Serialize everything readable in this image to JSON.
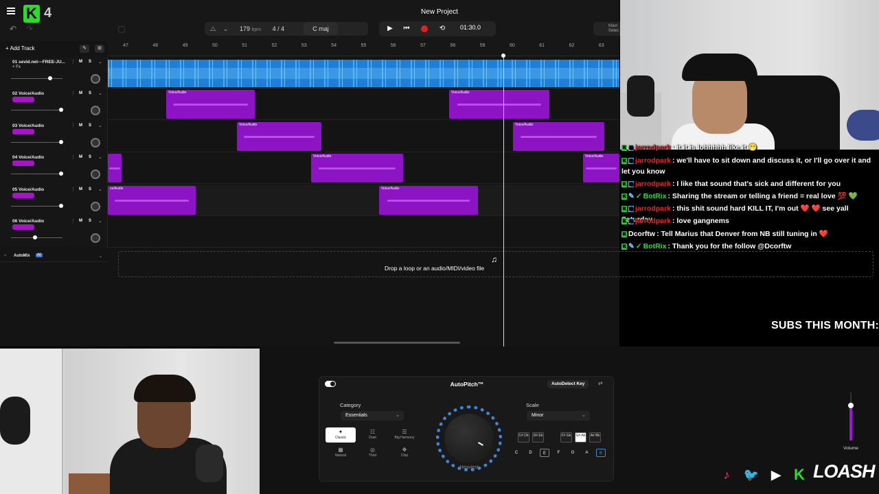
{
  "app": {
    "logo_letter": "K",
    "version": "4",
    "project_title": "New Project",
    "accent": "#2bdc2e"
  },
  "toolbar": {
    "bpm_value": "179",
    "bpm_unit": "bpm",
    "time_signature": "4 / 4",
    "key": "C maj",
    "time_display": "01:30.0",
    "master_label": "Mast",
    "master_sub": "Selec"
  },
  "track_header": {
    "add_track_label": "Add Track"
  },
  "ruler": [
    "47",
    "48",
    "49",
    "50",
    "51",
    "52",
    "53",
    "54",
    "55",
    "56",
    "57",
    "58",
    "59",
    "60",
    "61",
    "62",
    "63"
  ],
  "tracks": [
    {
      "name": "01  sevid.net---FREE-JU...",
      "sub": "+ Fx"
    },
    {
      "name": "02  Voice/Audio",
      "sub": ""
    },
    {
      "name": "03  Voice/Audio",
      "sub": ""
    },
    {
      "name": "04  Voice/Audio",
      "sub": ""
    },
    {
      "name": "05  Voice/Audio",
      "sub": ""
    },
    {
      "name": "06  Voice/Audio",
      "sub": ""
    }
  ],
  "track_buttons": {
    "mute": "M",
    "solo": "S"
  },
  "clips": {
    "label": "Voice/Audio",
    "partial_label": "ce/Audio"
  },
  "automix": {
    "label": "AutoMix",
    "badge": "AI"
  },
  "drop_zone": {
    "text": "Drop a loop or an audio/MIDI/video file"
  },
  "chat": [
    {
      "user": "jarrodpark",
      "user_color": "#e02828",
      "text": ": it it is lohhhhh like it 😁",
      "badges": [
        "k",
        "sq"
      ]
    },
    {
      "user": "jarrodpark",
      "user_color": "#e02828",
      "text": ": we'll have to sit down and discuss it, or I'll go over it and let you know",
      "badges": [
        "k",
        "sq"
      ]
    },
    {
      "user": "jarrodpark",
      "user_color": "#e02828",
      "text": ": I like that sound that's sick and different for you",
      "badges": [
        "k",
        "sq"
      ]
    },
    {
      "user": "BotRix",
      "user_color": "#2bdc2e",
      "text": ": Sharing the stream or telling a friend = real love 💯 💚",
      "badges": [
        "k",
        "wrench",
        "check"
      ]
    },
    {
      "user": "jarrodpark",
      "user_color": "#e02828",
      "text": ": this shit sound hard KILL IT, I'm out ❤️ ❤️ see yall Saturday",
      "badges": [
        "k",
        "sq"
      ]
    },
    {
      "user": "jarrodpark",
      "user_color": "#e02828",
      "text": ": love gangnems",
      "badges": [
        "k",
        "sq"
      ]
    },
    {
      "user": "Dcorftw",
      "user_color": "#ffffff",
      "text": ": Tell Marius that Denver from NB still tuning in ❤️",
      "badges": [
        "k"
      ]
    },
    {
      "user": "BotRix",
      "user_color": "#2bdc2e",
      "text": ": Thank you for the follow @Dcorftw",
      "badges": [
        "k",
        "wrench",
        "check"
      ]
    }
  ],
  "subs_label": "SUBS THIS MONTH:",
  "plugin": {
    "title": "AutoPitch™",
    "autodetect_label": "AutoDetect Key",
    "category_label": "Category",
    "category_value": "Essentials",
    "scale_label": "Scale",
    "scale_value": "Minor",
    "knob_label": "Heaviest",
    "styles": [
      "Classic",
      "Duet",
      "Big Harmony",
      "Natural",
      "Third",
      "Chip"
    ],
    "chords": [
      "C# Db",
      "D# Eb",
      "F# Gb",
      "G# Ab",
      "A# Bb"
    ],
    "notes": [
      "C",
      "D",
      "E",
      "F",
      "G",
      "A",
      "B"
    ]
  },
  "volume": {
    "label": "Volume",
    "level": 0.7
  },
  "branding": {
    "name": "LOASH"
  }
}
